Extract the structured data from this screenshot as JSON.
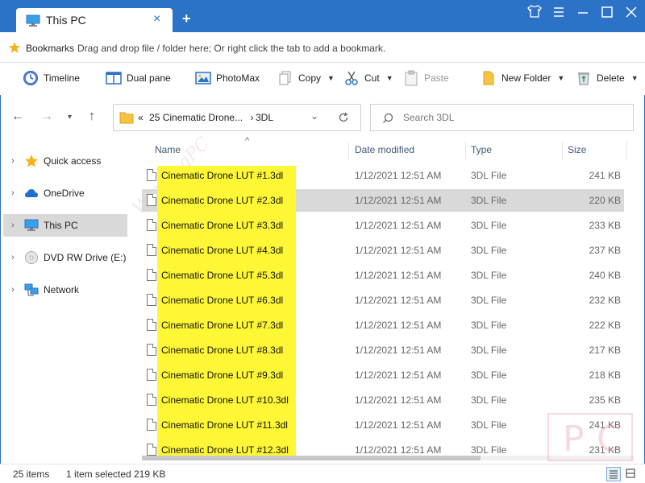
{
  "window": {
    "tab_title": "This PC",
    "tab_close": "×",
    "new_tab": "+"
  },
  "bookmarks": {
    "label": "Bookmarks",
    "hint": "Drag and drop file / folder here; Or right click the tab to add a bookmark."
  },
  "toolbar": {
    "timeline": "Timeline",
    "dual_pane": "Dual pane",
    "photomax": "PhotoMax",
    "copy": "Copy",
    "cut": "Cut",
    "paste": "Paste",
    "new_folder": "New Folder",
    "delete": "Delete"
  },
  "address": {
    "chevrons": "«",
    "path": "25 Cinematic Drone...",
    "current": "3DL"
  },
  "search": {
    "placeholder": "Search 3DL"
  },
  "nav": {
    "items": [
      {
        "label": "Quick access",
        "icon": "star-icon"
      },
      {
        "label": "OneDrive",
        "icon": "cloud-icon"
      },
      {
        "label": "This PC",
        "icon": "computer-icon",
        "selected": true
      },
      {
        "label": "DVD RW Drive (E:)",
        "icon": "disc-icon"
      },
      {
        "label": "Network",
        "icon": "network-icon"
      }
    ]
  },
  "columns": {
    "name": "Name",
    "date": "Date modified",
    "type": "Type",
    "size": "Size"
  },
  "files": [
    {
      "name": "Cinematic Drone LUT #1.3dl",
      "date": "1/12/2021 12:51 AM",
      "type": "3DL File",
      "size": "241 KB"
    },
    {
      "name": "Cinematic Drone LUT #2.3dl",
      "date": "1/12/2021 12:51 AM",
      "type": "3DL File",
      "size": "220 KB",
      "selected": true
    },
    {
      "name": "Cinematic Drone LUT #3.3dl",
      "date": "1/12/2021 12:51 AM",
      "type": "3DL File",
      "size": "233 KB"
    },
    {
      "name": "Cinematic Drone LUT #4.3dl",
      "date": "1/12/2021 12:51 AM",
      "type": "3DL File",
      "size": "237 KB"
    },
    {
      "name": "Cinematic Drone LUT #5.3dl",
      "date": "1/12/2021 12:51 AM",
      "type": "3DL File",
      "size": "240 KB"
    },
    {
      "name": "Cinematic Drone LUT #6.3dl",
      "date": "1/12/2021 12:51 AM",
      "type": "3DL File",
      "size": "232 KB"
    },
    {
      "name": "Cinematic Drone LUT #7.3dl",
      "date": "1/12/2021 12:51 AM",
      "type": "3DL File",
      "size": "222 KB"
    },
    {
      "name": "Cinematic Drone LUT #8.3dl",
      "date": "1/12/2021 12:51 AM",
      "type": "3DL File",
      "size": "217 KB"
    },
    {
      "name": "Cinematic Drone LUT #9.3dl",
      "date": "1/12/2021 12:51 AM",
      "type": "3DL File",
      "size": "218 KB"
    },
    {
      "name": "Cinematic Drone LUT #10.3dl",
      "date": "1/12/2021 12:51 AM",
      "type": "3DL File",
      "size": "235 KB"
    },
    {
      "name": "Cinematic Drone LUT #11.3dl",
      "date": "1/12/2021 12:51 AM",
      "type": "3DL File",
      "size": "241 KB"
    },
    {
      "name": "Cinematic Drone LUT #12.3dl",
      "date": "1/12/2021 12:51 AM",
      "type": "3DL File",
      "size": "231 KB"
    }
  ],
  "status": {
    "items": "25 items",
    "selected": "1 item selected",
    "selected_size": "219 KB"
  },
  "watermark": "WinningPC",
  "colors": {
    "accent": "#2c72c7",
    "highlight": "#fff735",
    "selection": "#d9d9d9"
  }
}
